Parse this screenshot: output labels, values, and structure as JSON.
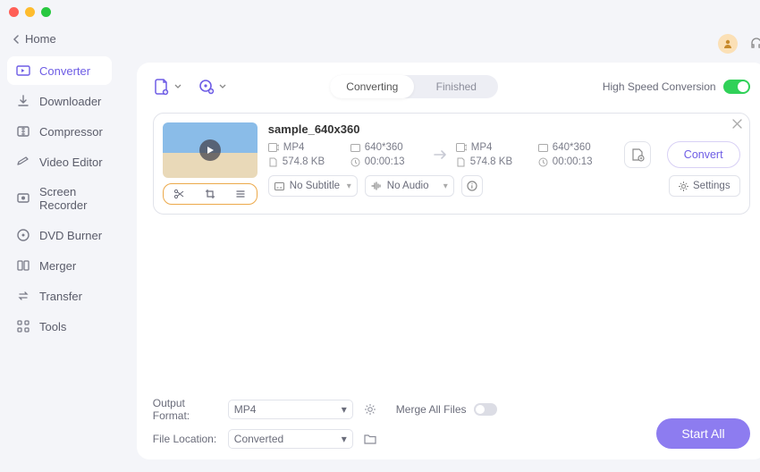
{
  "home_label": "Home",
  "sidebar": {
    "items": [
      {
        "label": "Converter",
        "icon": "converter"
      },
      {
        "label": "Downloader",
        "icon": "downloader"
      },
      {
        "label": "Compressor",
        "icon": "compressor"
      },
      {
        "label": "Video Editor",
        "icon": "editor"
      },
      {
        "label": "Screen Recorder",
        "icon": "recorder"
      },
      {
        "label": "DVD Burner",
        "icon": "burner"
      },
      {
        "label": "Merger",
        "icon": "merger"
      },
      {
        "label": "Transfer",
        "icon": "transfer"
      },
      {
        "label": "Tools",
        "icon": "tools"
      }
    ],
    "active_index": 0
  },
  "tabs": {
    "converting": "Converting",
    "finished": "Finished",
    "active": "converting"
  },
  "highspeed_label": "High Speed Conversion",
  "highspeed_on": true,
  "file": {
    "name": "sample_640x360",
    "src": {
      "format": "MP4",
      "resolution": "640*360",
      "size": "574.8 KB",
      "duration": "00:00:13"
    },
    "dst": {
      "format": "MP4",
      "resolution": "640*360",
      "size": "574.8 KB",
      "duration": "00:00:13"
    },
    "subtitle": "No Subtitle",
    "audio": "No Audio",
    "settings_label": "Settings",
    "convert_label": "Convert"
  },
  "footer": {
    "output_format_label": "Output Format:",
    "output_format_value": "MP4",
    "file_location_label": "File Location:",
    "file_location_value": "Converted",
    "merge_label": "Merge All Files",
    "merge_on": false,
    "start_all_label": "Start All"
  }
}
